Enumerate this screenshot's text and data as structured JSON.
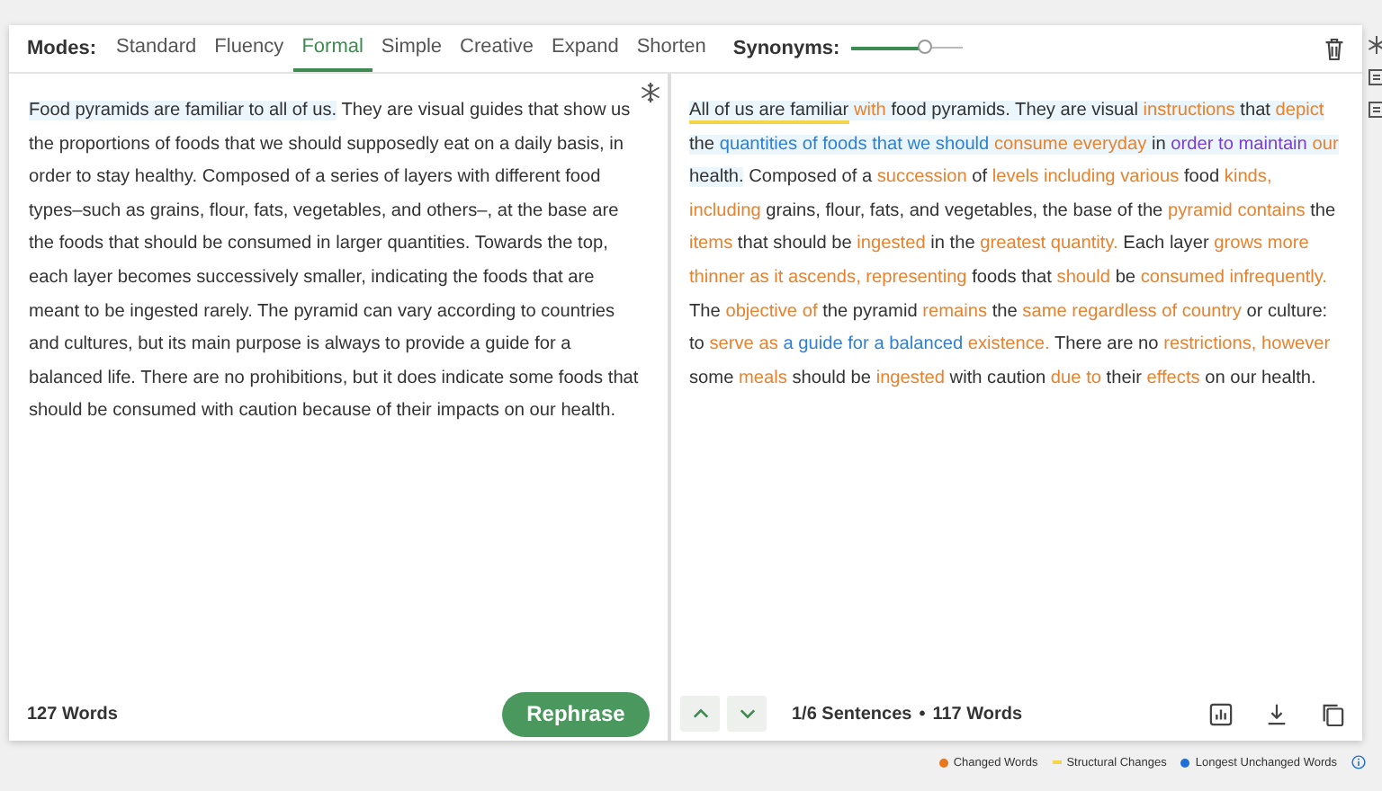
{
  "modes": {
    "label": "Modes:",
    "items": [
      {
        "label": "Standard",
        "selected": false
      },
      {
        "label": "Fluency",
        "selected": false
      },
      {
        "label": "Formal",
        "selected": true
      },
      {
        "label": "Simple",
        "selected": false
      },
      {
        "label": "Creative",
        "selected": false
      },
      {
        "label": "Expand",
        "selected": false
      },
      {
        "label": "Shorten",
        "selected": false
      }
    ]
  },
  "synonyms": {
    "label": "Synonyms:",
    "level": 0.67
  },
  "input": {
    "segments": [
      {
        "text": "Food pyramids are familiar to all of us.",
        "highlighted": true
      },
      {
        "text": " They are visual guides that show us the proportions of foods that we should supposedly eat on a daily basis, in order to stay healthy. Composed of a series of layers with different food types–such as grains, flour, fats, vegetables, and others–, at the base are the foods that should be consumed in larger quantities. Towards the top, each layer becomes successively smaller, indicating the foods that are meant to be ingested rarely. The pyramid can vary according to countries and cultures, but its main purpose is always to provide a guide for a balanced life. There are no prohibitions, but it does indicate some foods that should be consumed with caution because of their impacts on our health.",
        "highlighted": false
      }
    ],
    "word_count": "127 Words",
    "button": "Rephrase"
  },
  "output": {
    "segments": [
      {
        "text": "All of us are familiar",
        "kind": "structural",
        "highlighted": true
      },
      {
        "text": " with",
        "kind": "changed",
        "highlighted": true
      },
      {
        "text": " food pyramids. They are visual ",
        "kind": "plain",
        "highlighted": true
      },
      {
        "text": "instructions",
        "kind": "changed",
        "highlighted": true
      },
      {
        "text": " that ",
        "kind": "plain",
        "highlighted": true
      },
      {
        "text": "depict",
        "kind": "changed",
        "highlighted": true
      },
      {
        "text": " the ",
        "kind": "plain",
        "highlighted": true
      },
      {
        "text": "quantities of foods that we should",
        "kind": "unchanged",
        "highlighted": true
      },
      {
        "text": " consume everyday",
        "kind": "changed",
        "highlighted": true
      },
      {
        "text": " in ",
        "kind": "plain",
        "highlighted": true
      },
      {
        "text": "order to maintain",
        "kind": "structural_word",
        "highlighted": true
      },
      {
        "text": " our",
        "kind": "changed",
        "highlighted": true
      },
      {
        "text": " health.",
        "kind": "plain",
        "highlighted": true
      },
      {
        "text": " Composed of a ",
        "kind": "plain",
        "highlighted": false
      },
      {
        "text": "succession",
        "kind": "changed",
        "highlighted": false
      },
      {
        "text": " of ",
        "kind": "plain",
        "highlighted": false
      },
      {
        "text": "levels including various",
        "kind": "changed",
        "highlighted": false
      },
      {
        "text": " food ",
        "kind": "plain",
        "highlighted": false
      },
      {
        "text": "kinds, including",
        "kind": "changed",
        "highlighted": false
      },
      {
        "text": " grains, flour, fats, and vegetables, the base of the ",
        "kind": "plain",
        "highlighted": false
      },
      {
        "text": "pyramid contains",
        "kind": "changed",
        "highlighted": false
      },
      {
        "text": " the ",
        "kind": "plain",
        "highlighted": false
      },
      {
        "text": "items",
        "kind": "changed",
        "highlighted": false
      },
      {
        "text": " that should be ",
        "kind": "plain",
        "highlighted": false
      },
      {
        "text": "ingested",
        "kind": "changed",
        "highlighted": false
      },
      {
        "text": " in the ",
        "kind": "plain",
        "highlighted": false
      },
      {
        "text": "greatest quantity.",
        "kind": "changed",
        "highlighted": false
      },
      {
        "text": " Each layer ",
        "kind": "plain",
        "highlighted": false
      },
      {
        "text": "grows more thinner as it ascends, representing",
        "kind": "changed",
        "highlighted": false
      },
      {
        "text": " foods that ",
        "kind": "plain",
        "highlighted": false
      },
      {
        "text": "should",
        "kind": "changed",
        "highlighted": false
      },
      {
        "text": " be ",
        "kind": "plain",
        "highlighted": false
      },
      {
        "text": "consumed infrequently.",
        "kind": "changed",
        "highlighted": false
      },
      {
        "text": " The ",
        "kind": "plain",
        "highlighted": false
      },
      {
        "text": "objective of",
        "kind": "changed",
        "highlighted": false
      },
      {
        "text": " the pyramid ",
        "kind": "plain",
        "highlighted": false
      },
      {
        "text": "remains",
        "kind": "changed",
        "highlighted": false
      },
      {
        "text": " the ",
        "kind": "plain",
        "highlighted": false
      },
      {
        "text": "same regardless of country",
        "kind": "changed",
        "highlighted": false
      },
      {
        "text": " or culture: to ",
        "kind": "plain",
        "highlighted": false
      },
      {
        "text": "serve as",
        "kind": "changed",
        "highlighted": false
      },
      {
        "text": " a guide for a balanced",
        "kind": "unchanged",
        "highlighted": false
      },
      {
        "text": " existence.",
        "kind": "changed",
        "highlighted": false
      },
      {
        "text": " There are no ",
        "kind": "plain",
        "highlighted": false
      },
      {
        "text": "restrictions, however",
        "kind": "changed",
        "highlighted": false
      },
      {
        "text": " some ",
        "kind": "plain",
        "highlighted": false
      },
      {
        "text": "meals",
        "kind": "changed",
        "highlighted": false
      },
      {
        "text": " should be ",
        "kind": "plain",
        "highlighted": false
      },
      {
        "text": "ingested",
        "kind": "changed",
        "highlighted": false
      },
      {
        "text": " with caution ",
        "kind": "plain",
        "highlighted": false
      },
      {
        "text": "due to",
        "kind": "changed",
        "highlighted": false
      },
      {
        "text": " their ",
        "kind": "plain",
        "highlighted": false
      },
      {
        "text": "effects",
        "kind": "changed",
        "highlighted": false
      },
      {
        "text": " on our health.",
        "kind": "plain",
        "highlighted": false
      }
    ],
    "sentences": "1/6 Sentences",
    "bullet": "•",
    "word_count": "117 Words"
  },
  "legend": [
    {
      "label": "Changed Words",
      "kind": "dot",
      "color": "#e8761f"
    },
    {
      "label": "Structural Changes",
      "kind": "line",
      "color": "#f5d44a"
    },
    {
      "label": "Longest Unchanged Words",
      "kind": "dot",
      "color": "#1f6fd6"
    }
  ]
}
